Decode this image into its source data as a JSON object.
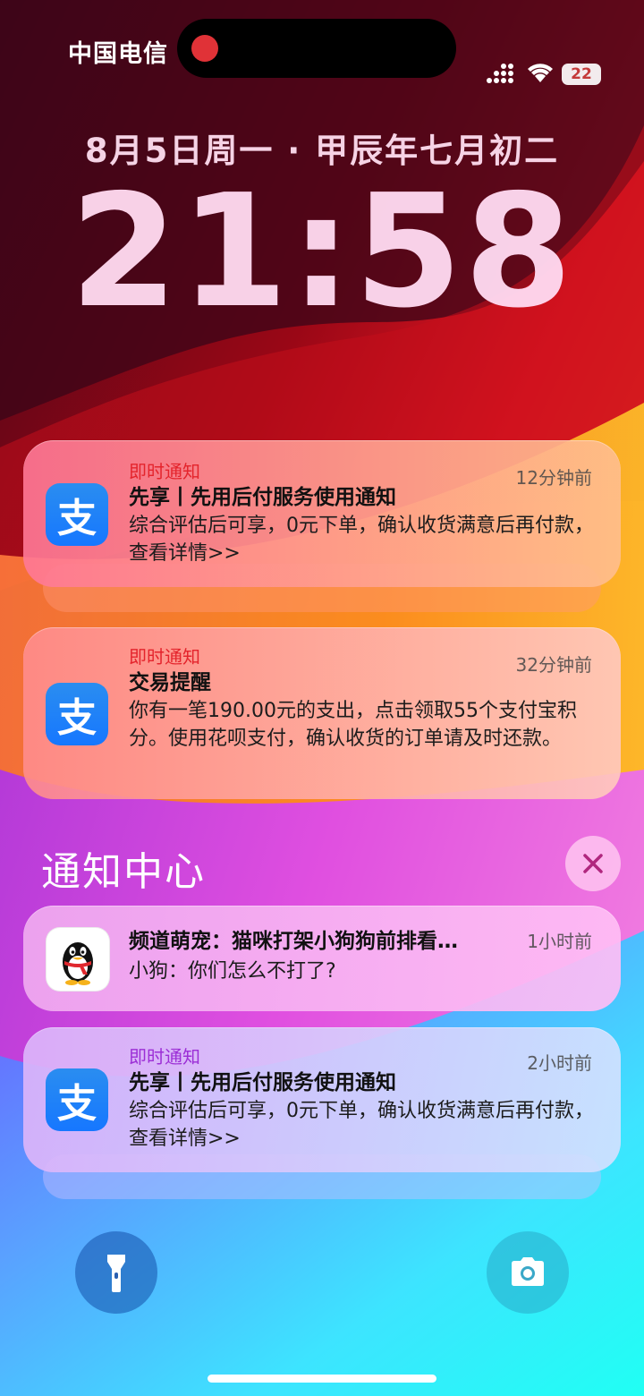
{
  "status_bar": {
    "carrier": "中国电信",
    "battery_level": "22",
    "icons": [
      "signal-icon",
      "wifi-icon",
      "battery-icon"
    ]
  },
  "lockscreen": {
    "date": "8月5日周一 · 甲辰年七月初二",
    "time": "21:58"
  },
  "notifications_top": [
    {
      "app_icon": "alipay-icon",
      "tag": "即时通知",
      "title": "先享丨先用后付服务使用通知",
      "body": "综合评估后可享，0元下单，确认收货满意后再付款，查看详情>>",
      "time": "12分钟前"
    },
    {
      "app_icon": "alipay-icon",
      "tag": "即时通知",
      "title": "交易提醒",
      "body": "你有一笔190.00元的支出，点击领取55个支付宝积分。使用花呗支付，确认收货的订单请及时还款。",
      "time": "32分钟前"
    }
  ],
  "notification_center": {
    "title": "通知中心",
    "close_icon": "close-icon"
  },
  "notifications_center": [
    {
      "app_icon": "qq-penguin-icon",
      "title": "频道萌宠：猫咪打架小狗狗前排看…",
      "body": "小狗：你们怎么不打了?",
      "time": "1小时前"
    },
    {
      "app_icon": "alipay-icon",
      "tag": "即时通知",
      "title": "先享丨先用后付服务使用通知",
      "body": "综合评估后可享，0元下单，确认收货满意后再付款，查看详情>>",
      "time": "2小时前"
    }
  ],
  "alipay_glyph": "支",
  "quick_actions": {
    "left_icon": "flashlight-icon",
    "right_icon": "camera-icon"
  },
  "colors": {
    "tag_red": "#e4242c",
    "tag_purple": "#9c2fd6",
    "alipay_blue": "#1677ff"
  }
}
